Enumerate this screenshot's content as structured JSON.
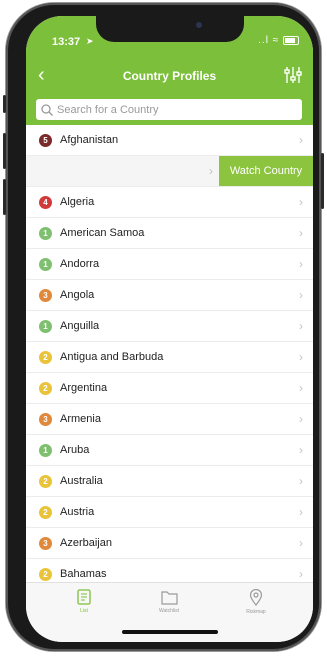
{
  "status_bar": {
    "time": "13:37",
    "signal": "..l",
    "wifi": "≈"
  },
  "navbar": {
    "title": "Country Profiles"
  },
  "search": {
    "placeholder": "Search for a Country"
  },
  "swipe_action": {
    "label": "Watch Country"
  },
  "countries": [
    {
      "name": "Afghanistan",
      "score": "5",
      "color": "#7a2a2a"
    },
    {
      "name": "",
      "score": "",
      "color": ""
    },
    {
      "name": "Algeria",
      "score": "4",
      "color": "#d23a3a"
    },
    {
      "name": "American Samoa",
      "score": "1",
      "color": "#7ec06f"
    },
    {
      "name": "Andorra",
      "score": "1",
      "color": "#7ec06f"
    },
    {
      "name": "Angola",
      "score": "3",
      "color": "#e0893a"
    },
    {
      "name": "Anguilla",
      "score": "1",
      "color": "#7ec06f"
    },
    {
      "name": "Antigua and Barbuda",
      "score": "2",
      "color": "#e9c43b"
    },
    {
      "name": "Argentina",
      "score": "2",
      "color": "#e9c43b"
    },
    {
      "name": "Armenia",
      "score": "3",
      "color": "#e0893a"
    },
    {
      "name": "Aruba",
      "score": "1",
      "color": "#7ec06f"
    },
    {
      "name": "Australia",
      "score": "2",
      "color": "#e9c43b"
    },
    {
      "name": "Austria",
      "score": "2",
      "color": "#e9c43b"
    },
    {
      "name": "Azerbaijan",
      "score": "3",
      "color": "#e0893a"
    },
    {
      "name": "Bahamas",
      "score": "2",
      "color": "#e9c43b"
    }
  ],
  "tabs": {
    "list": "List",
    "watchlist": "Watchlist",
    "riskmap": "Riskmap"
  },
  "colors": {
    "brand_green": "#7cbf3a",
    "action_green": "#8cc43f"
  }
}
